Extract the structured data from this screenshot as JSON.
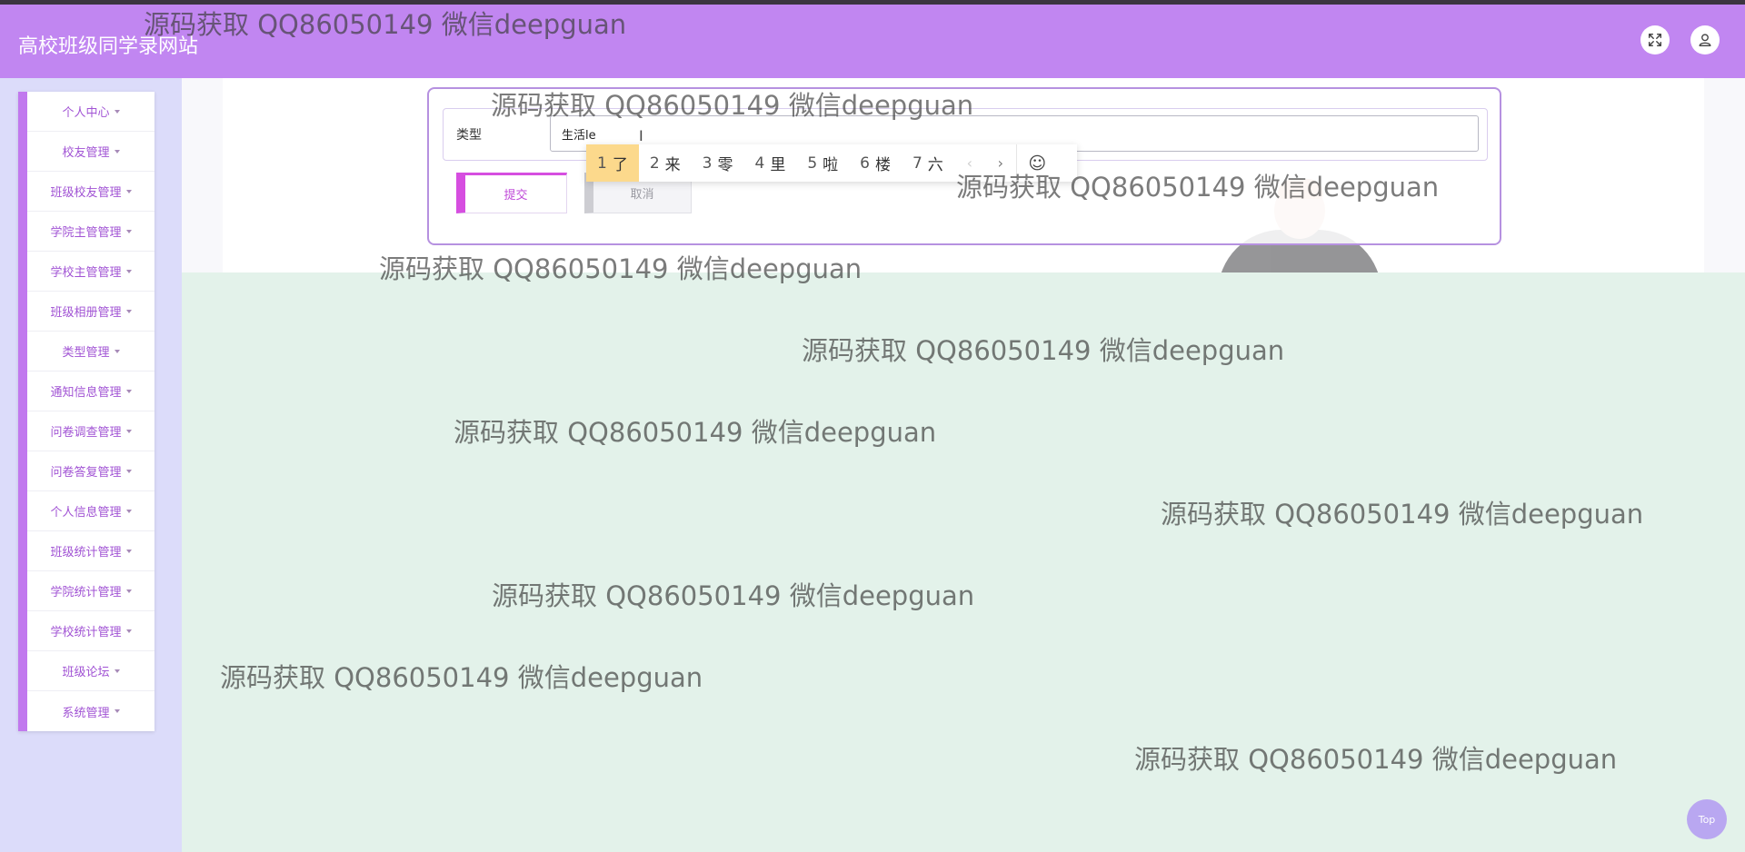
{
  "header": {
    "title": "高校班级同学录网站",
    "fullscreen_icon": "fullscreen-icon",
    "user_icon": "user-icon"
  },
  "sidebar": {
    "items": [
      {
        "label": "个人中心"
      },
      {
        "label": "校友管理"
      },
      {
        "label": "班级校友管理"
      },
      {
        "label": "学院主管管理"
      },
      {
        "label": "学校主管管理"
      },
      {
        "label": "班级相册管理"
      },
      {
        "label": "类型管理"
      },
      {
        "label": "通知信息管理"
      },
      {
        "label": "问卷调查管理"
      },
      {
        "label": "问卷答复管理"
      },
      {
        "label": "个人信息管理"
      },
      {
        "label": "班级统计管理"
      },
      {
        "label": "学院统计管理"
      },
      {
        "label": "学校统计管理"
      },
      {
        "label": "班级论坛"
      },
      {
        "label": "系统管理"
      }
    ]
  },
  "form": {
    "type_label": "类型",
    "type_value": "生活le",
    "submit_label": "提交",
    "cancel_label": "取消"
  },
  "ime": {
    "candidates": [
      {
        "num": "1",
        "text": "了"
      },
      {
        "num": "2",
        "text": "来"
      },
      {
        "num": "3",
        "text": "零"
      },
      {
        "num": "4",
        "text": "里"
      },
      {
        "num": "5",
        "text": "啦"
      },
      {
        "num": "6",
        "text": "楼"
      },
      {
        "num": "7",
        "text": "六"
      }
    ],
    "prev": "‹",
    "next": "›",
    "emoji": "☺"
  },
  "watermark": "源码获取 QQ86050149 微信deepguan",
  "back_to_top": "Top",
  "colors": {
    "header": "#c186f1",
    "sidebar_bg": "#dcdcfa",
    "menu_accent": "#c179ee",
    "content_bg": "#e3f2ea",
    "submit_accent": "#d64ee0"
  }
}
